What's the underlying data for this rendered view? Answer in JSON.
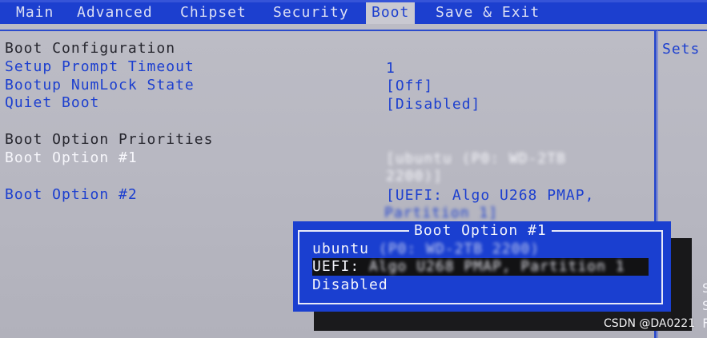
{
  "menu": {
    "tabs": [
      {
        "label": "Main",
        "active": false
      },
      {
        "label": "Advanced",
        "active": false
      },
      {
        "label": "Chipset",
        "active": false
      },
      {
        "label": "Security",
        "active": false
      },
      {
        "label": "Boot",
        "active": true
      },
      {
        "label": "Save & Exit",
        "active": false
      }
    ]
  },
  "boot_config": {
    "heading": "Boot Configuration",
    "items": [
      {
        "label": "Setup Prompt Timeout",
        "value": "1"
      },
      {
        "label": "Bootup NumLock State",
        "value": "[Off]"
      },
      {
        "label": "Quiet Boot",
        "value": "[Disabled]"
      }
    ]
  },
  "boot_priorities": {
    "heading": "Boot Option Priorities",
    "items": [
      {
        "label": "Boot Option #1",
        "value_line1": "[ubuntu (P0: WD-2TB",
        "value_line2": "2200)]",
        "selected": true
      },
      {
        "label": "Boot Option #2",
        "value_line1": "[UEFI: Algo U268 PMAP,",
        "value_line2": "Partition 1]",
        "selected": false
      }
    ]
  },
  "help_panel": {
    "text": "Sets",
    "fragments": [
      "S",
      "S",
      "F"
    ]
  },
  "popup": {
    "title": "Boot Option #1",
    "options": [
      {
        "prefix": "ubuntu",
        "detail": "(P0: WD-2TB 2200)",
        "highlighted": false
      },
      {
        "prefix": "UEFI:",
        "detail": "Algo U268 PMAP, Partition 1",
        "highlighted": true
      },
      {
        "prefix": "Disabled",
        "detail": "",
        "highlighted": false
      }
    ]
  },
  "watermark": "CSDN @DA0221"
}
